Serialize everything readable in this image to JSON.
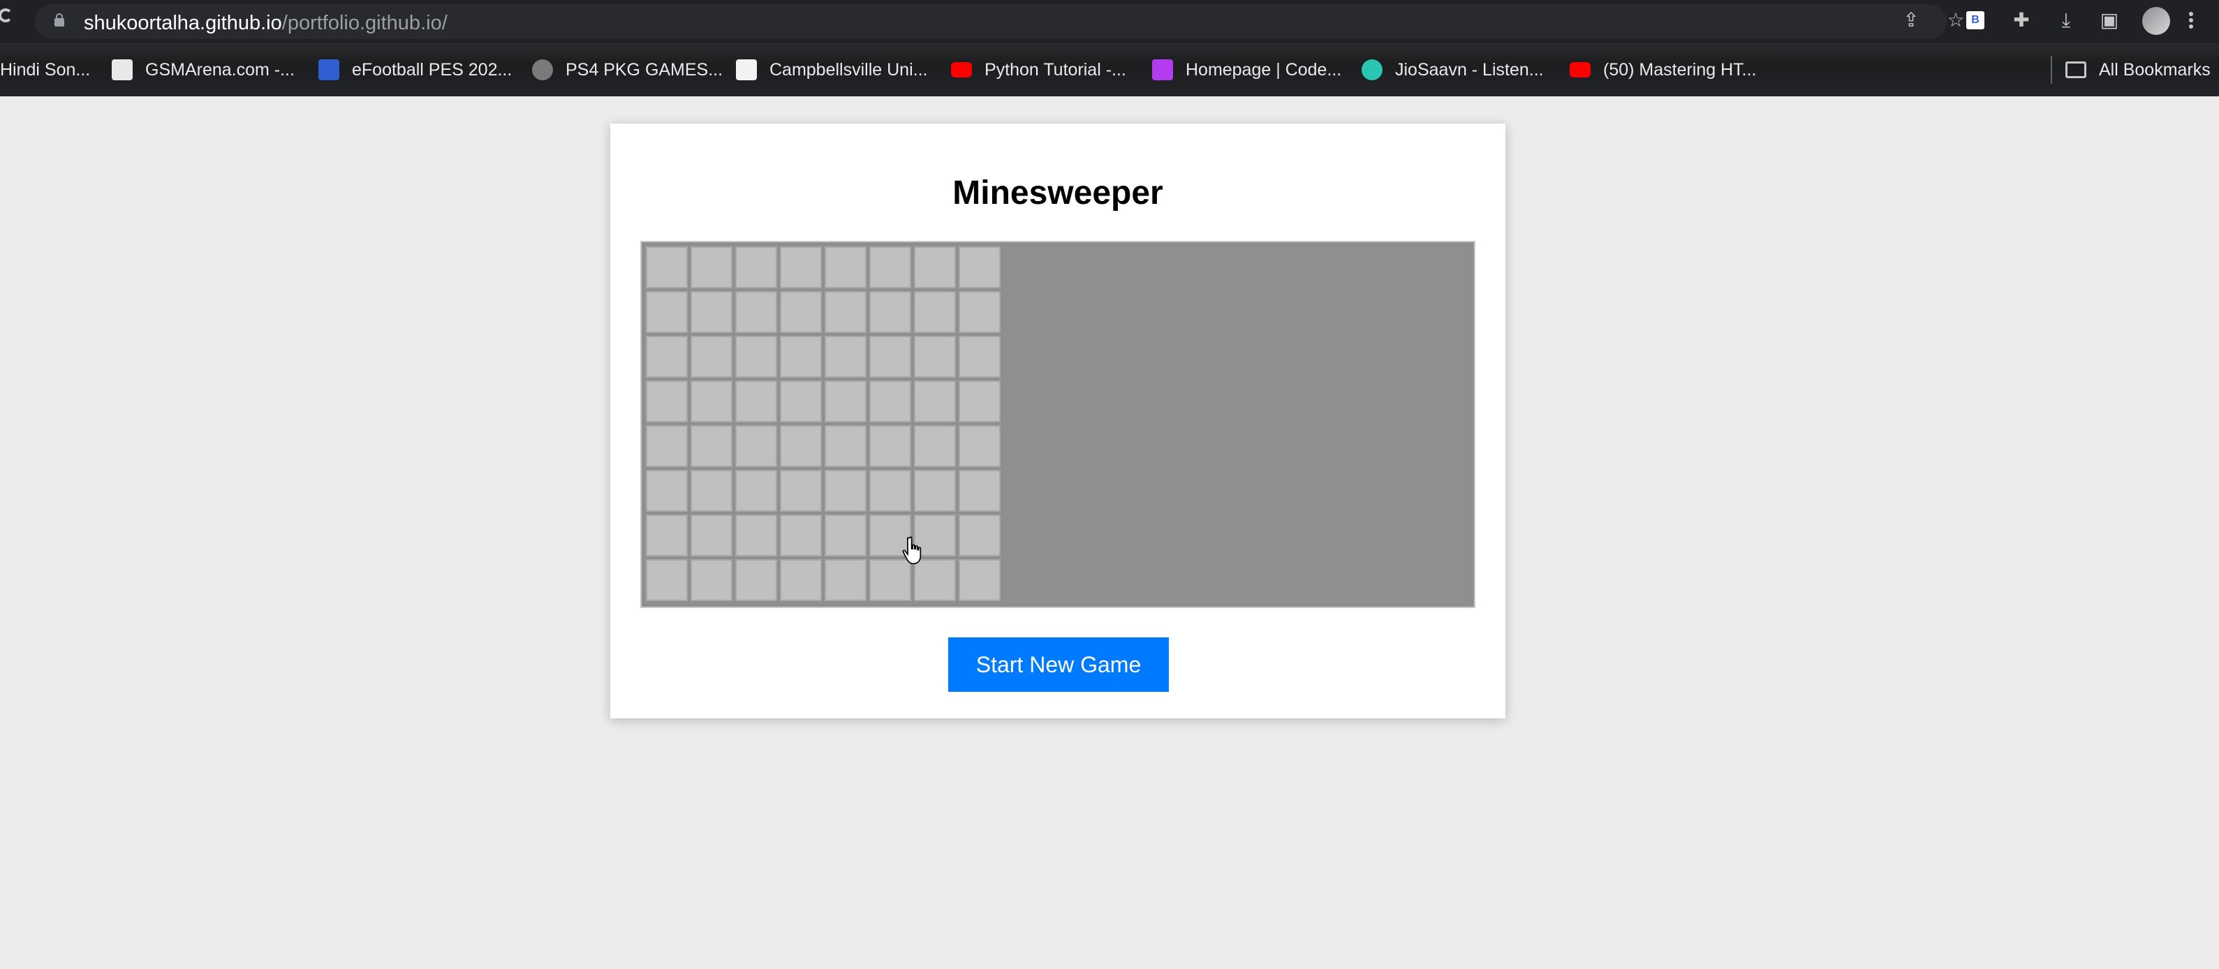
{
  "browser": {
    "url_host": "shukoortalha.github.io",
    "url_path": "/portfolio.github.io/",
    "extension_badge": "B",
    "bookmarks": [
      {
        "label": "Hindi Son...",
        "icon_color": "#000000"
      },
      {
        "label": "GSMArena.com -...",
        "icon_color": "#c0392b"
      },
      {
        "label": "eFootball PES 202...",
        "icon_color": "#2f5fd0"
      },
      {
        "label": "PS4 PKG GAMES...",
        "icon_color": "#7a7a7a"
      },
      {
        "label": "Campbellsville Uni...",
        "icon_color": "#f2f2f2"
      },
      {
        "label": "Python Tutorial -...",
        "icon_color": "#ff0000"
      },
      {
        "label": "Homepage | Code...",
        "icon_color": "#b43cf0"
      },
      {
        "label": "JioSaavn - Listen...",
        "icon_color": "#2bc5b4"
      },
      {
        "label": "(50) Mastering HT...",
        "icon_color": "#ff0000"
      }
    ],
    "all_bookmarks_label": "All Bookmarks"
  },
  "page": {
    "title": "Minesweeper",
    "grid": {
      "rows": 8,
      "cols": 8
    },
    "new_game_button": "Start New Game"
  },
  "colors": {
    "button": "#007bff",
    "board_bg": "#8f8f8f",
    "cell": "#c0c0c0"
  }
}
